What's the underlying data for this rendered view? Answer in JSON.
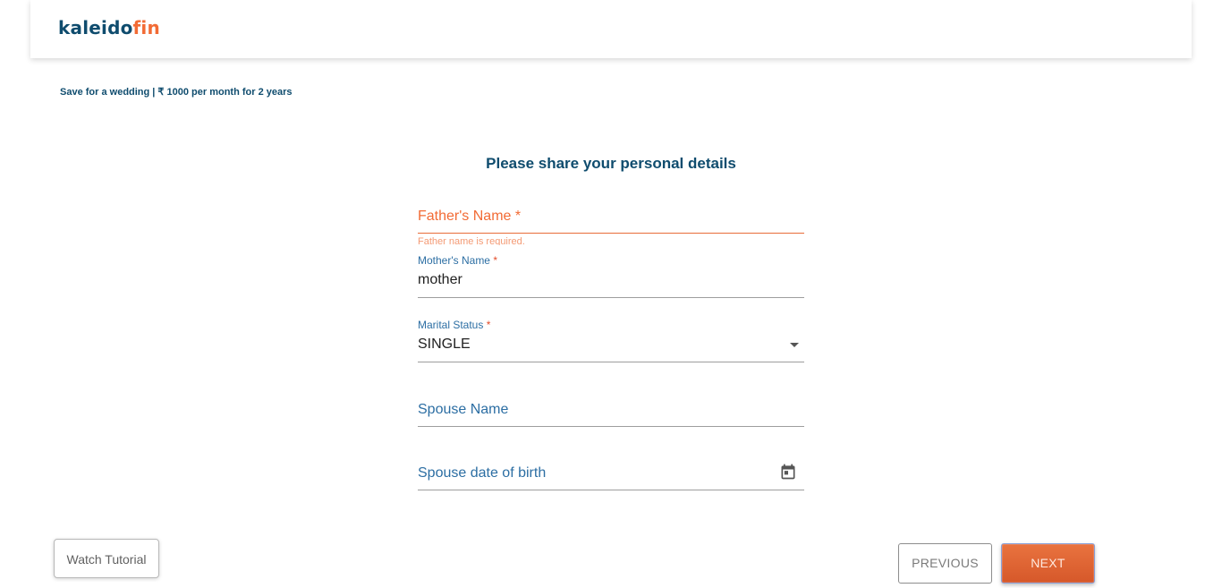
{
  "header": {
    "logo_part1": "kaleido",
    "logo_part2": "fin"
  },
  "goal_summary": "Save for a wedding | ₹ 1000 per month for 2 years",
  "form": {
    "title": "Please share your personal details",
    "fathers_name": {
      "label": "Father's Name",
      "required_mark": "*",
      "value": "",
      "error": "Father name is required."
    },
    "mothers_name": {
      "label": "Mother's Name",
      "required_mark": "*",
      "value": "mother"
    },
    "marital_status": {
      "label": "Marital Status",
      "required_mark": "*",
      "value": "SINGLE"
    },
    "spouse_name": {
      "label": "Spouse Name",
      "value": ""
    },
    "spouse_dob": {
      "label": "Spouse date of birth",
      "value": "",
      "icon": "calendar-icon"
    }
  },
  "buttons": {
    "watch_tutorial": "Watch Tutorial",
    "previous": "PREVIOUS",
    "next": "NEXT"
  },
  "colors": {
    "brand_primary": "#0f4c6e",
    "brand_accent": "#f26b35",
    "label_blue": "#2c6ea3",
    "error": "#f26b35"
  }
}
